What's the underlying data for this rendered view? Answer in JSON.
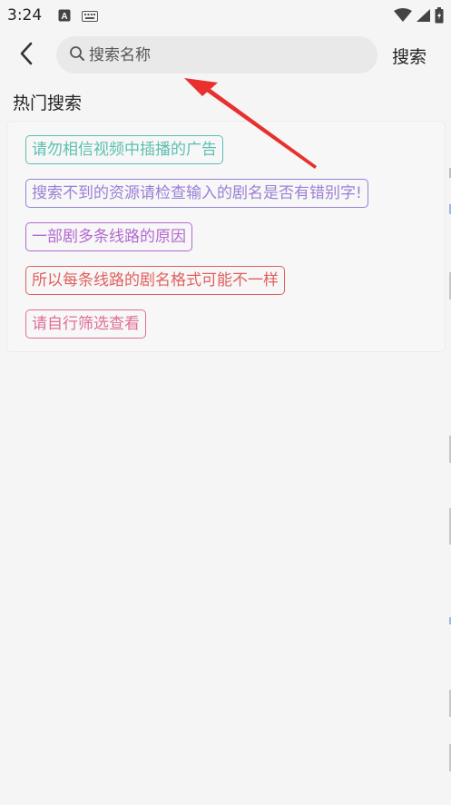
{
  "status_bar": {
    "time": "3:24",
    "icons": [
      "a-box-icon",
      "keyboard-icon",
      "wifi-icon",
      "signal-icon",
      "battery-icon"
    ]
  },
  "toolbar": {
    "back_icon": "chevron-left-icon",
    "search_icon": "search-icon",
    "search_placeholder": "搜索名称",
    "search_value": "",
    "search_button_label": "搜索"
  },
  "hot_search": {
    "title": "热门搜索",
    "tags": [
      {
        "label": "请勿相信视频中插播的广告",
        "color": "#5cbfb0"
      },
      {
        "label": "搜索不到的资源请检查输入的剧名是否有错别字!",
        "color": "#9c7fd6"
      },
      {
        "label": "一部剧多条线路的原因",
        "color": "#b36ad0"
      },
      {
        "label": "所以每条线路的剧名格式可能不一样",
        "color": "#e06060"
      },
      {
        "label": "请自行筛选查看",
        "color": "#df6f9a"
      }
    ]
  },
  "annotation": {
    "color": "#e8302e"
  }
}
